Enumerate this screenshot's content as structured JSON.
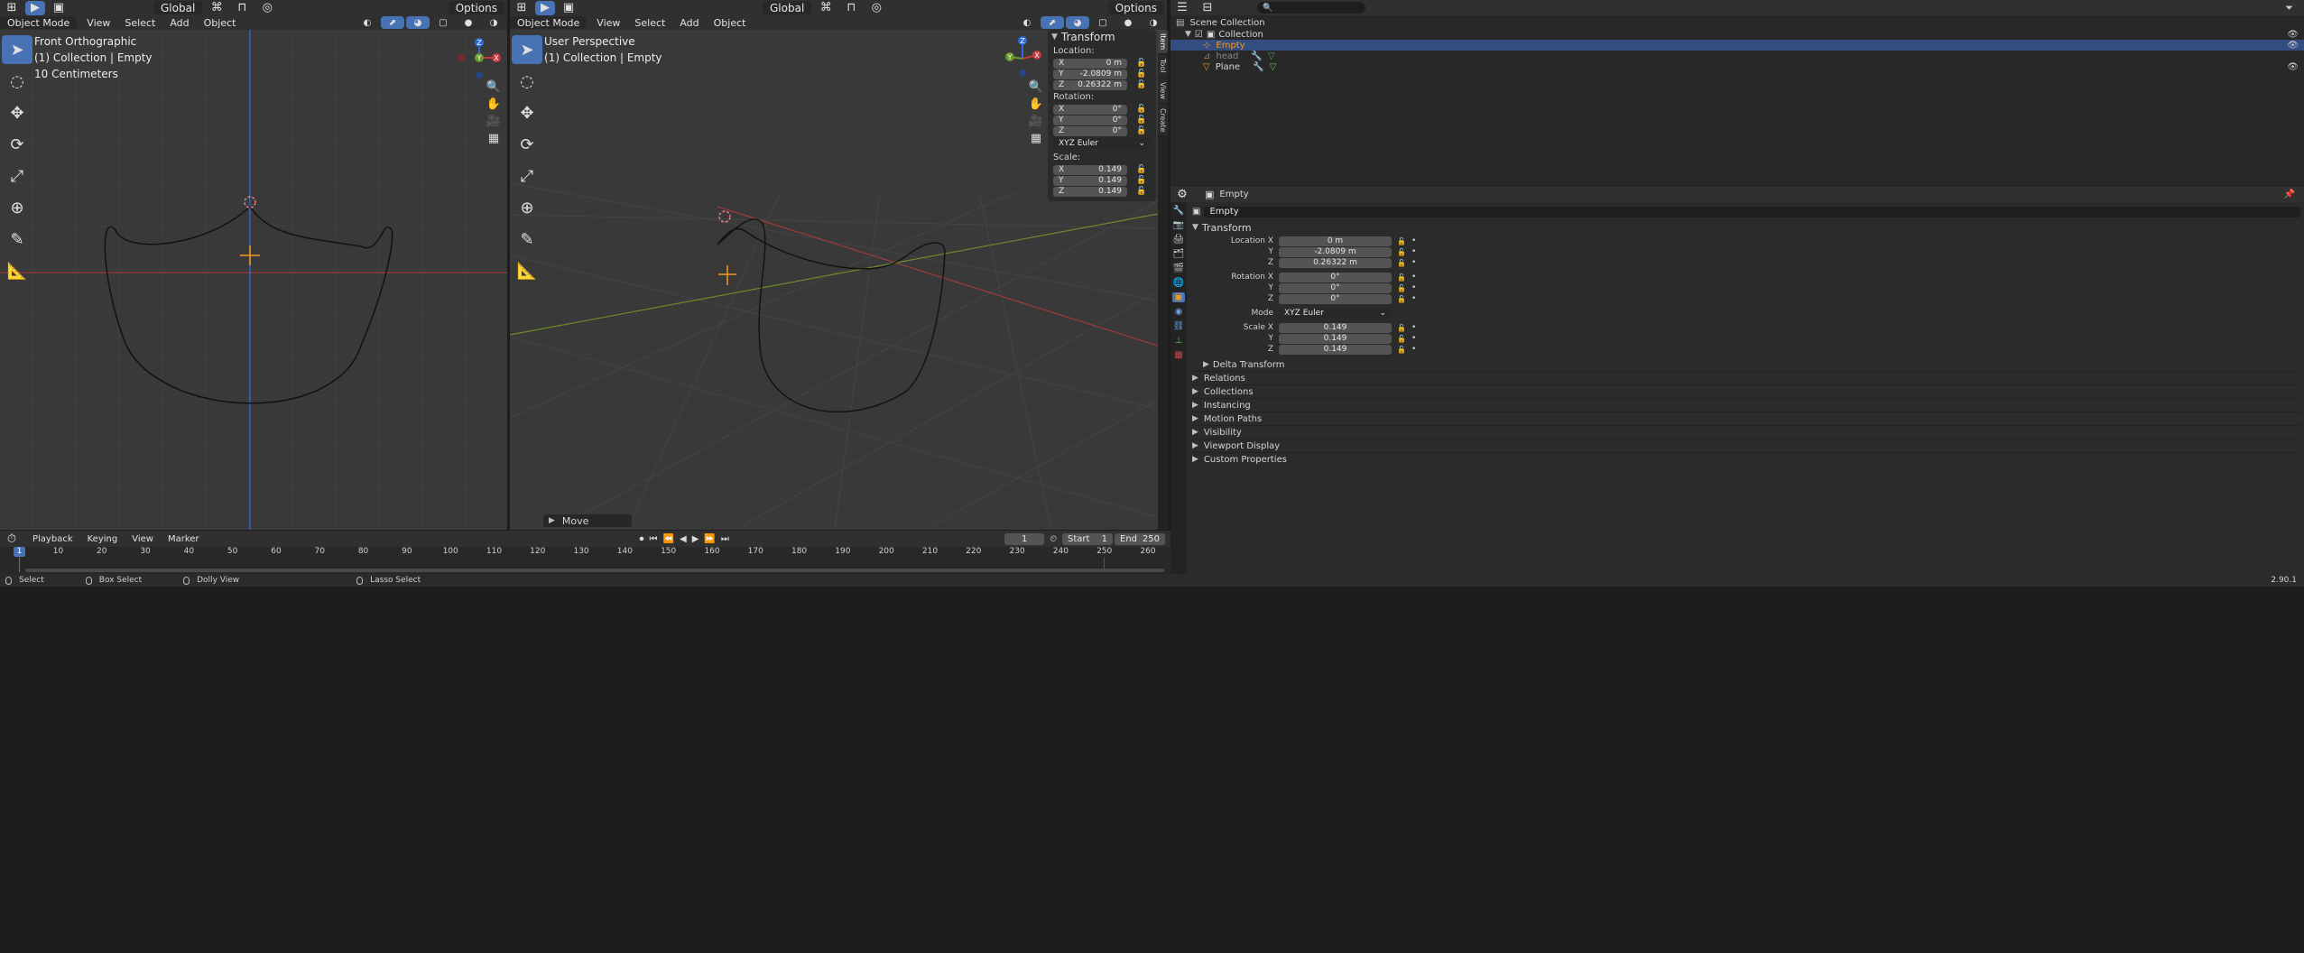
{
  "top_bar_left": {
    "mode": "Object Mode",
    "menus": [
      "View",
      "Select",
      "Add",
      "Object"
    ],
    "orientation": "Global",
    "options": "Options"
  },
  "left_viewport": {
    "view_name": "Front Orthographic",
    "collection_info": "(1) Collection | Empty",
    "scale_info": "10 Centimeters",
    "gizmo": {
      "z": "Z",
      "y": "Y",
      "x": "X"
    }
  },
  "right_viewport": {
    "view_name": "User Perspective",
    "collection_info": "(1) Collection | Empty",
    "gizmo": {
      "z": "Z",
      "y": "Y",
      "x": "X"
    },
    "operator_panel": "Move"
  },
  "n_panel": {
    "tabs": [
      "Item",
      "Tool",
      "View",
      "Create"
    ],
    "section": "Transform",
    "location_label": "Location:",
    "location": [
      {
        "axis": "X",
        "value": "0 m"
      },
      {
        "axis": "Y",
        "value": "-2.0809 m"
      },
      {
        "axis": "Z",
        "value": "0.26322 m"
      }
    ],
    "rotation_label": "Rotation:",
    "rotation": [
      {
        "axis": "X",
        "value": "0°"
      },
      {
        "axis": "Y",
        "value": "0°"
      },
      {
        "axis": "Z",
        "value": "0°"
      }
    ],
    "rotation_mode": "XYZ Euler",
    "scale_label": "Scale:",
    "scale": [
      {
        "axis": "X",
        "value": "0.149"
      },
      {
        "axis": "Y",
        "value": "0.149"
      },
      {
        "axis": "Z",
        "value": "0.149"
      }
    ]
  },
  "outliner": {
    "scene_collection": "Scene Collection",
    "items": [
      {
        "name": "Collection"
      },
      {
        "name": "Empty"
      },
      {
        "name": "head"
      },
      {
        "name": "Plane"
      }
    ]
  },
  "properties": {
    "object_name": "Empty",
    "datablock_name": "Empty",
    "transform_title": "Transform",
    "location_x_label": "Location X",
    "location": [
      "0 m",
      "-2.0809 m",
      "0.26322 m"
    ],
    "rotation_x_label": "Rotation X",
    "rotation": [
      "0°",
      "0°",
      "0°"
    ],
    "y_label": "Y",
    "z_label": "Z",
    "mode_label": "Mode",
    "mode_value": "XYZ Euler",
    "scale_x_label": "Scale X",
    "scale": [
      "0.149",
      "0.149",
      "0.149"
    ],
    "delta_transform": "Delta Transform",
    "panels": [
      "Relations",
      "Collections",
      "Instancing",
      "Motion Paths",
      "Visibility",
      "Viewport Display",
      "Custom Properties"
    ]
  },
  "timeline": {
    "menus": [
      "Playback",
      "Keying",
      "View",
      "Marker"
    ],
    "current_frame": "1",
    "start_label": "Start",
    "start_value": "1",
    "end_label": "End",
    "end_value": "250",
    "ruler_current": "1",
    "ruler_labels": [
      "10",
      "20",
      "30",
      "40",
      "50",
      "60",
      "70",
      "80",
      "90",
      "100",
      "110",
      "120",
      "130",
      "140",
      "150",
      "160",
      "170",
      "180",
      "190",
      "200",
      "210",
      "220",
      "230",
      "240",
      "250",
      "260"
    ]
  },
  "status_bar": {
    "items": [
      "Select",
      "Box Select",
      "Dolly View",
      "Lasso Select"
    ],
    "version": "2.90.1"
  },
  "colors": {
    "accent": "#4772b3",
    "selected_row": "#334d80",
    "x_axis": "#c8393f",
    "y_axis": "#6b9a2c",
    "z_axis": "#2e6bd8",
    "empty_orange": "#f29a1e"
  }
}
